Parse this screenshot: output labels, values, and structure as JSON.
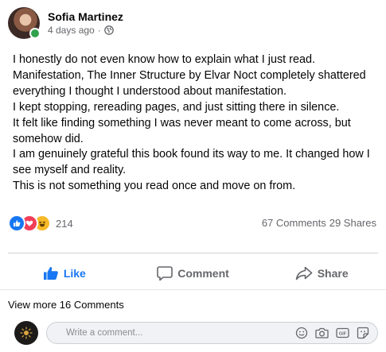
{
  "post": {
    "author": "Sofia Martinez",
    "time": "4 days ago",
    "separator": "·",
    "privacy_icon": "globe-icon",
    "body_lines": [
      "I honestly do not even know how to explain what I just read.",
      "Manifestation, The Inner Structure by Elvar Noct completely shattered everything I thought I understood about manifestation.",
      "I kept stopping, rereading pages, and just sitting there in silence.",
      "It felt like finding something I was never meant to come across, but somehow did.",
      "I am genuinely grateful this book found its way to me. It changed how I see myself and reality.",
      "This is not something you read once and move on from."
    ]
  },
  "reactions": {
    "icons": [
      "like-reaction-icon",
      "love-reaction-icon",
      "haha-reaction-icon"
    ],
    "count": "214",
    "comments": "67 Comments",
    "shares": "29 Shares"
  },
  "actions": {
    "like": "Like",
    "comment": "Comment",
    "share": "Share"
  },
  "comments": {
    "view_more": "View more 16 Comments",
    "placeholder": "Write a comment...",
    "input_icons": [
      "emoji-icon",
      "camera-icon",
      "gif-icon",
      "sticker-icon"
    ]
  },
  "colors": {
    "accent": "#1877f2",
    "online": "#31a24c",
    "love": "#f33e58",
    "haha": "#f7b928",
    "muted_text": "#65676b"
  }
}
